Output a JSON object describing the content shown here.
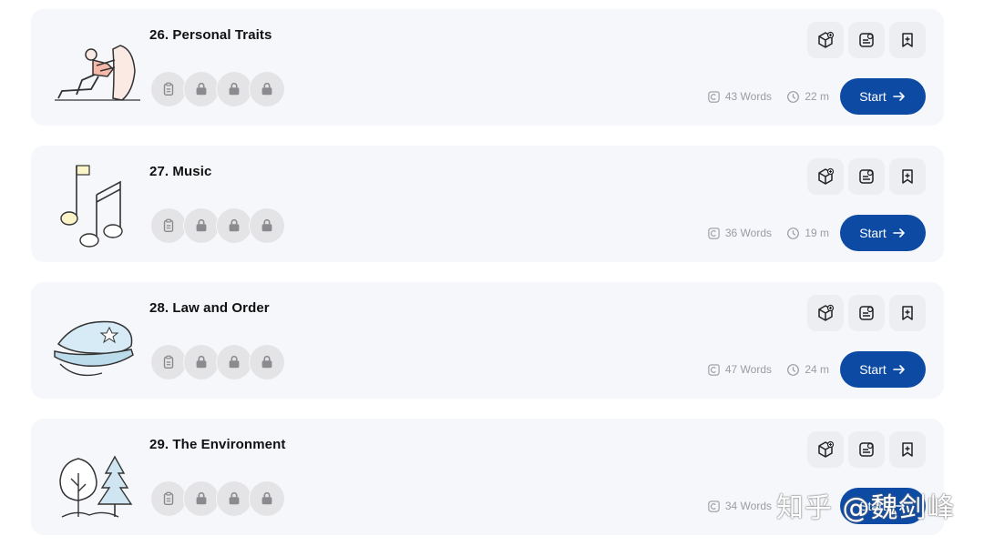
{
  "lessons": [
    {
      "title": "26. Personal Traits",
      "words": "43 Words",
      "time": "22 m",
      "start_label": "Start",
      "illustration": "person-pushing-rock-illustration"
    },
    {
      "title": "27. Music",
      "words": "36 Words",
      "time": "19 m",
      "start_label": "Start",
      "illustration": "music-notes-illustration"
    },
    {
      "title": "28. Law and Order",
      "words": "47 Words",
      "time": "24 m",
      "start_label": "Start",
      "illustration": "police-cap-illustration"
    },
    {
      "title": "29. The Environment",
      "words": "34 Words",
      "time": "",
      "start_label": "Start",
      "illustration": "trees-illustration"
    }
  ],
  "badge_icons": [
    "clipboard-icon",
    "lock-icon",
    "lock-icon",
    "lock-icon"
  ],
  "action_icons": [
    "cube-plus-icon",
    "flashcard-icon",
    "bookmark-add-icon"
  ],
  "colors": {
    "accent": "#0d4aa3",
    "card_bg": "#f5f7fb",
    "badge_bg": "#e4e4e6",
    "muted_text": "#9a9ca3"
  },
  "watermark": "知乎 @魏剑峰"
}
